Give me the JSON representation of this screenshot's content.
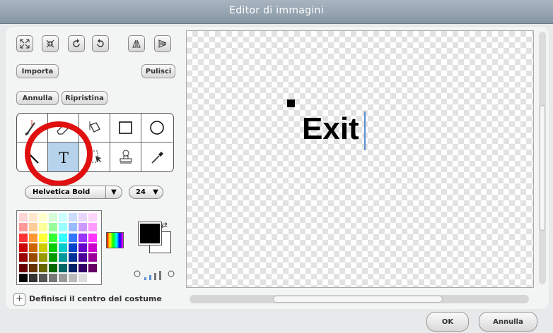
{
  "window": {
    "title": "Editor di immagini"
  },
  "buttons": {
    "import": "Importa",
    "clear": "Pulisci",
    "undo": "Annulla",
    "redo": "Ripristina",
    "ok": "OK",
    "cancel": "Annulla"
  },
  "icon_row": [
    "grow-icon",
    "shrink-icon",
    "rotate-left-icon",
    "rotate-right-icon",
    "flip-horizontal-icon",
    "flip-vertical-icon"
  ],
  "tools": [
    "paintbrush-icon",
    "eraser-icon",
    "fill-bucket-icon",
    "rectangle-icon",
    "ellipse-icon",
    "line-icon",
    "text-tool-icon",
    "select-icon",
    "stamp-icon",
    "eyedropper-icon"
  ],
  "selected_tool": "text-tool-icon",
  "font": {
    "name": "Helvetica Bold",
    "size": "24"
  },
  "zoom": {
    "levels": 4,
    "level": 2
  },
  "canvas": {
    "text": "Exit"
  },
  "costume_center": {
    "label": "Definisci il centro del costume"
  },
  "colors": {
    "foreground": "#000000",
    "background": "#ffffff",
    "highlight": "#e01010",
    "canvas_text": "#000000"
  }
}
